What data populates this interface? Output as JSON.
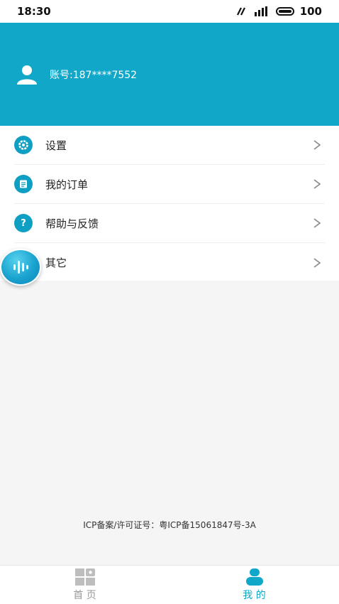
{
  "status_bar": {
    "time": "18:30",
    "battery": "100"
  },
  "header": {
    "account": "账号:187****7552"
  },
  "menu": {
    "items": [
      {
        "label": "设置",
        "icon": "gear-icon"
      },
      {
        "label": "我的订单",
        "icon": "order-icon"
      },
      {
        "label": "帮助与反馈",
        "icon": "help-icon",
        "glyph": "?"
      },
      {
        "label": "其它",
        "icon": "more-icon"
      }
    ]
  },
  "footer": {
    "icp": "ICP备案/许可证号：粤ICP备15061847号-3A"
  },
  "tabbar": {
    "home": "首 页",
    "mine": "我 的"
  },
  "colors": {
    "accent": "#11a7c8",
    "inactive": "#999999",
    "background": "#f5f5f5"
  }
}
